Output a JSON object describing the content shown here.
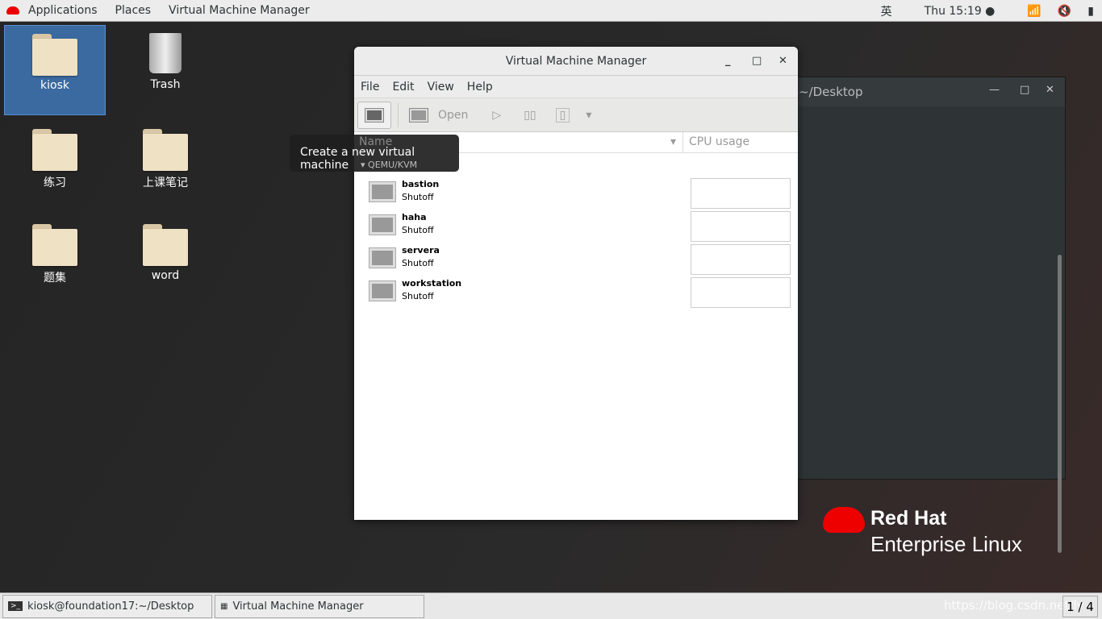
{
  "topbar": {
    "menus": [
      "Applications",
      "Places",
      "Virtual Machine Manager"
    ],
    "input_method": "英",
    "clock": "Thu 15:19",
    "icons": [
      "wifi-icon",
      "volume-muted-icon",
      "battery-icon"
    ]
  },
  "desktop": {
    "icons": [
      {
        "label": "kiosk",
        "type": "home-folder"
      },
      {
        "label": "Trash",
        "type": "trash"
      },
      {
        "label": "练习",
        "type": "folder"
      },
      {
        "label": "上课笔记",
        "type": "folder"
      },
      {
        "label": "题集",
        "type": "folder"
      },
      {
        "label": "word",
        "type": "folder"
      }
    ]
  },
  "terminal": {
    "title": "~/Desktop"
  },
  "vmm": {
    "title": "Virtual Machine Manager",
    "menu": [
      "File",
      "Edit",
      "View",
      "Help"
    ],
    "toolbar": {
      "open": "Open"
    },
    "columns": {
      "name": "Name",
      "cpu": "CPU usage"
    },
    "group": "QEMU/KVM",
    "vms": [
      {
        "name": "bastion",
        "status": "Shutoff"
      },
      {
        "name": "haha",
        "status": "Shutoff"
      },
      {
        "name": "servera",
        "status": "Shutoff"
      },
      {
        "name": "workstation",
        "status": "Shutoff"
      }
    ],
    "tooltip": "Create a new virtual machine"
  },
  "brand": {
    "line1": "Red Hat",
    "line2": "Enterprise Linux",
    "color": "#ee0000"
  },
  "taskbar": {
    "items": [
      "kiosk@foundation17:~/Desktop",
      "Virtual Machine Manager"
    ],
    "workspace": "1 / 4",
    "watermark": "https://blog.csdn.net/ly"
  }
}
